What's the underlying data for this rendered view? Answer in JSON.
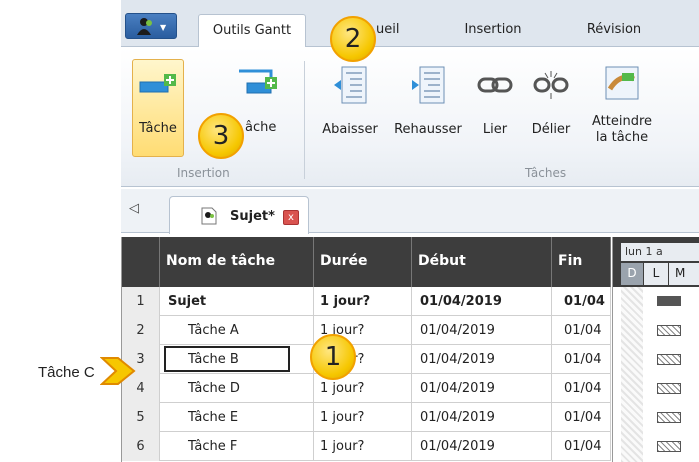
{
  "ribbon_tabs": [
    "Outils Gantt",
    "Accueil",
    "Insertion",
    "Révision"
  ],
  "ribbon_tabs_visible": [
    "Outils Gantt",
    "ueil",
    "Insertion",
    "Révision"
  ],
  "insertion_group": {
    "label": "Insertion",
    "buttons": [
      "Tâche",
      "âche"
    ]
  },
  "taches_group": {
    "label": "Tâches",
    "buttons": [
      "Abaisser",
      "Rehausser",
      "Lier",
      "Délier",
      "Atteindre",
      "la tâche"
    ]
  },
  "doc_tab": {
    "title": "Sujet*",
    "close": "x"
  },
  "table": {
    "headers": [
      "Nom de tâche",
      "Durée",
      "Début",
      "Fin"
    ],
    "rows": [
      {
        "num": "1",
        "name": "Sujet",
        "duration": "1 jour?",
        "start": "01/04/2019",
        "end": "01/04"
      },
      {
        "num": "2",
        "name": "Tâche A",
        "duration": "1 jour?",
        "start": "01/04/2019",
        "end": "01/04"
      },
      {
        "num": "3",
        "name": "Tâche B",
        "duration": "1 jour?",
        "start": "01/04/2019",
        "end": "01/04"
      },
      {
        "num": "4",
        "name": "Tâche D",
        "duration": "1 jour?",
        "start": "01/04/2019",
        "end": "01/04"
      },
      {
        "num": "5",
        "name": "Tâche E",
        "duration": "1 jour?",
        "start": "01/04/2019",
        "end": "01/04"
      },
      {
        "num": "6",
        "name": "Tâche F",
        "duration": "1 jour?",
        "start": "01/04/2019",
        "end": "01/04"
      }
    ]
  },
  "gantt": {
    "date": "lun 1 a",
    "days": [
      "D",
      "L",
      "M"
    ]
  },
  "callouts": [
    "1",
    "2",
    "3"
  ],
  "side_label": "Tâche C",
  "colors": {
    "callout_yellow": "#f6c700",
    "header_dark": "#3d3d3d",
    "selected_button": "#ffdc73"
  }
}
